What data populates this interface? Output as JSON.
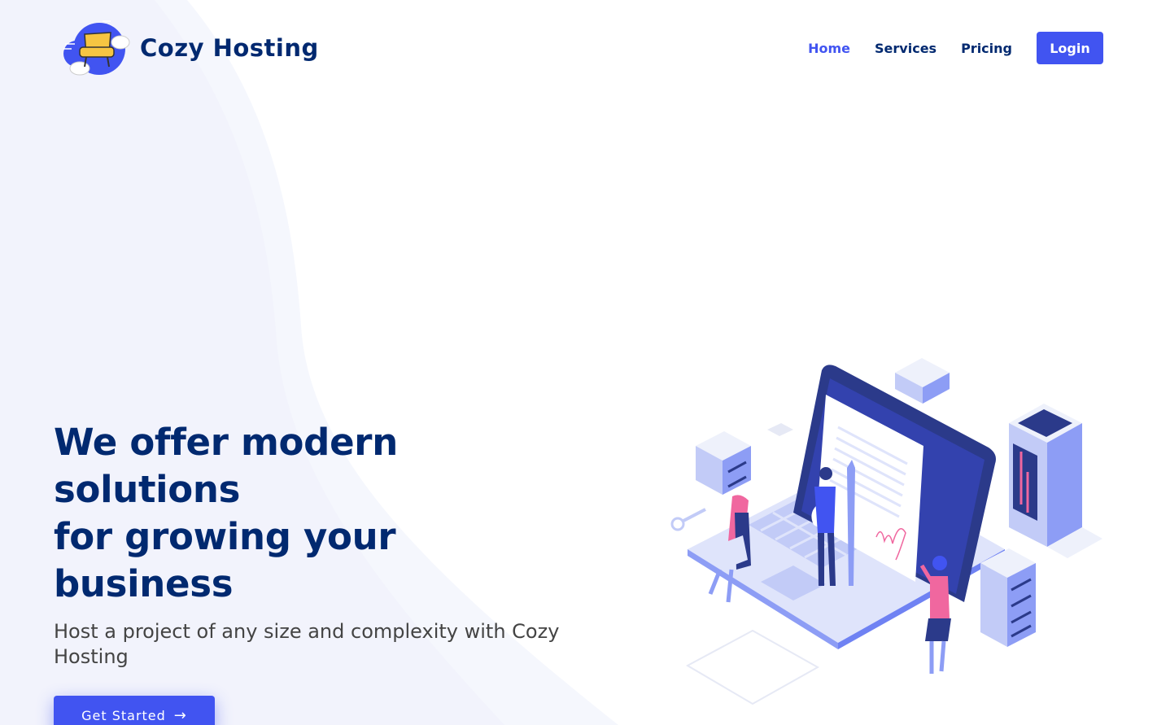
{
  "header": {
    "brand": "Cozy Hosting",
    "logo_icon": "cloud-armchair-logo-icon"
  },
  "nav": {
    "items": [
      {
        "label": "Home",
        "active": true
      },
      {
        "label": "Services",
        "active": false
      },
      {
        "label": "Pricing",
        "active": false
      }
    ],
    "login": "Login"
  },
  "hero": {
    "title_line1": "We offer modern solutions",
    "title_line2": "for growing your business",
    "subtitle": "Host a project of any size and complexity with Cozy Hosting",
    "cta_label": "Get Started",
    "cta_icon": "arrow-right-icon"
  },
  "colors": {
    "primary": "#4154f1",
    "heading": "#012970",
    "text": "#444444",
    "accent_pink": "#f0679f"
  }
}
